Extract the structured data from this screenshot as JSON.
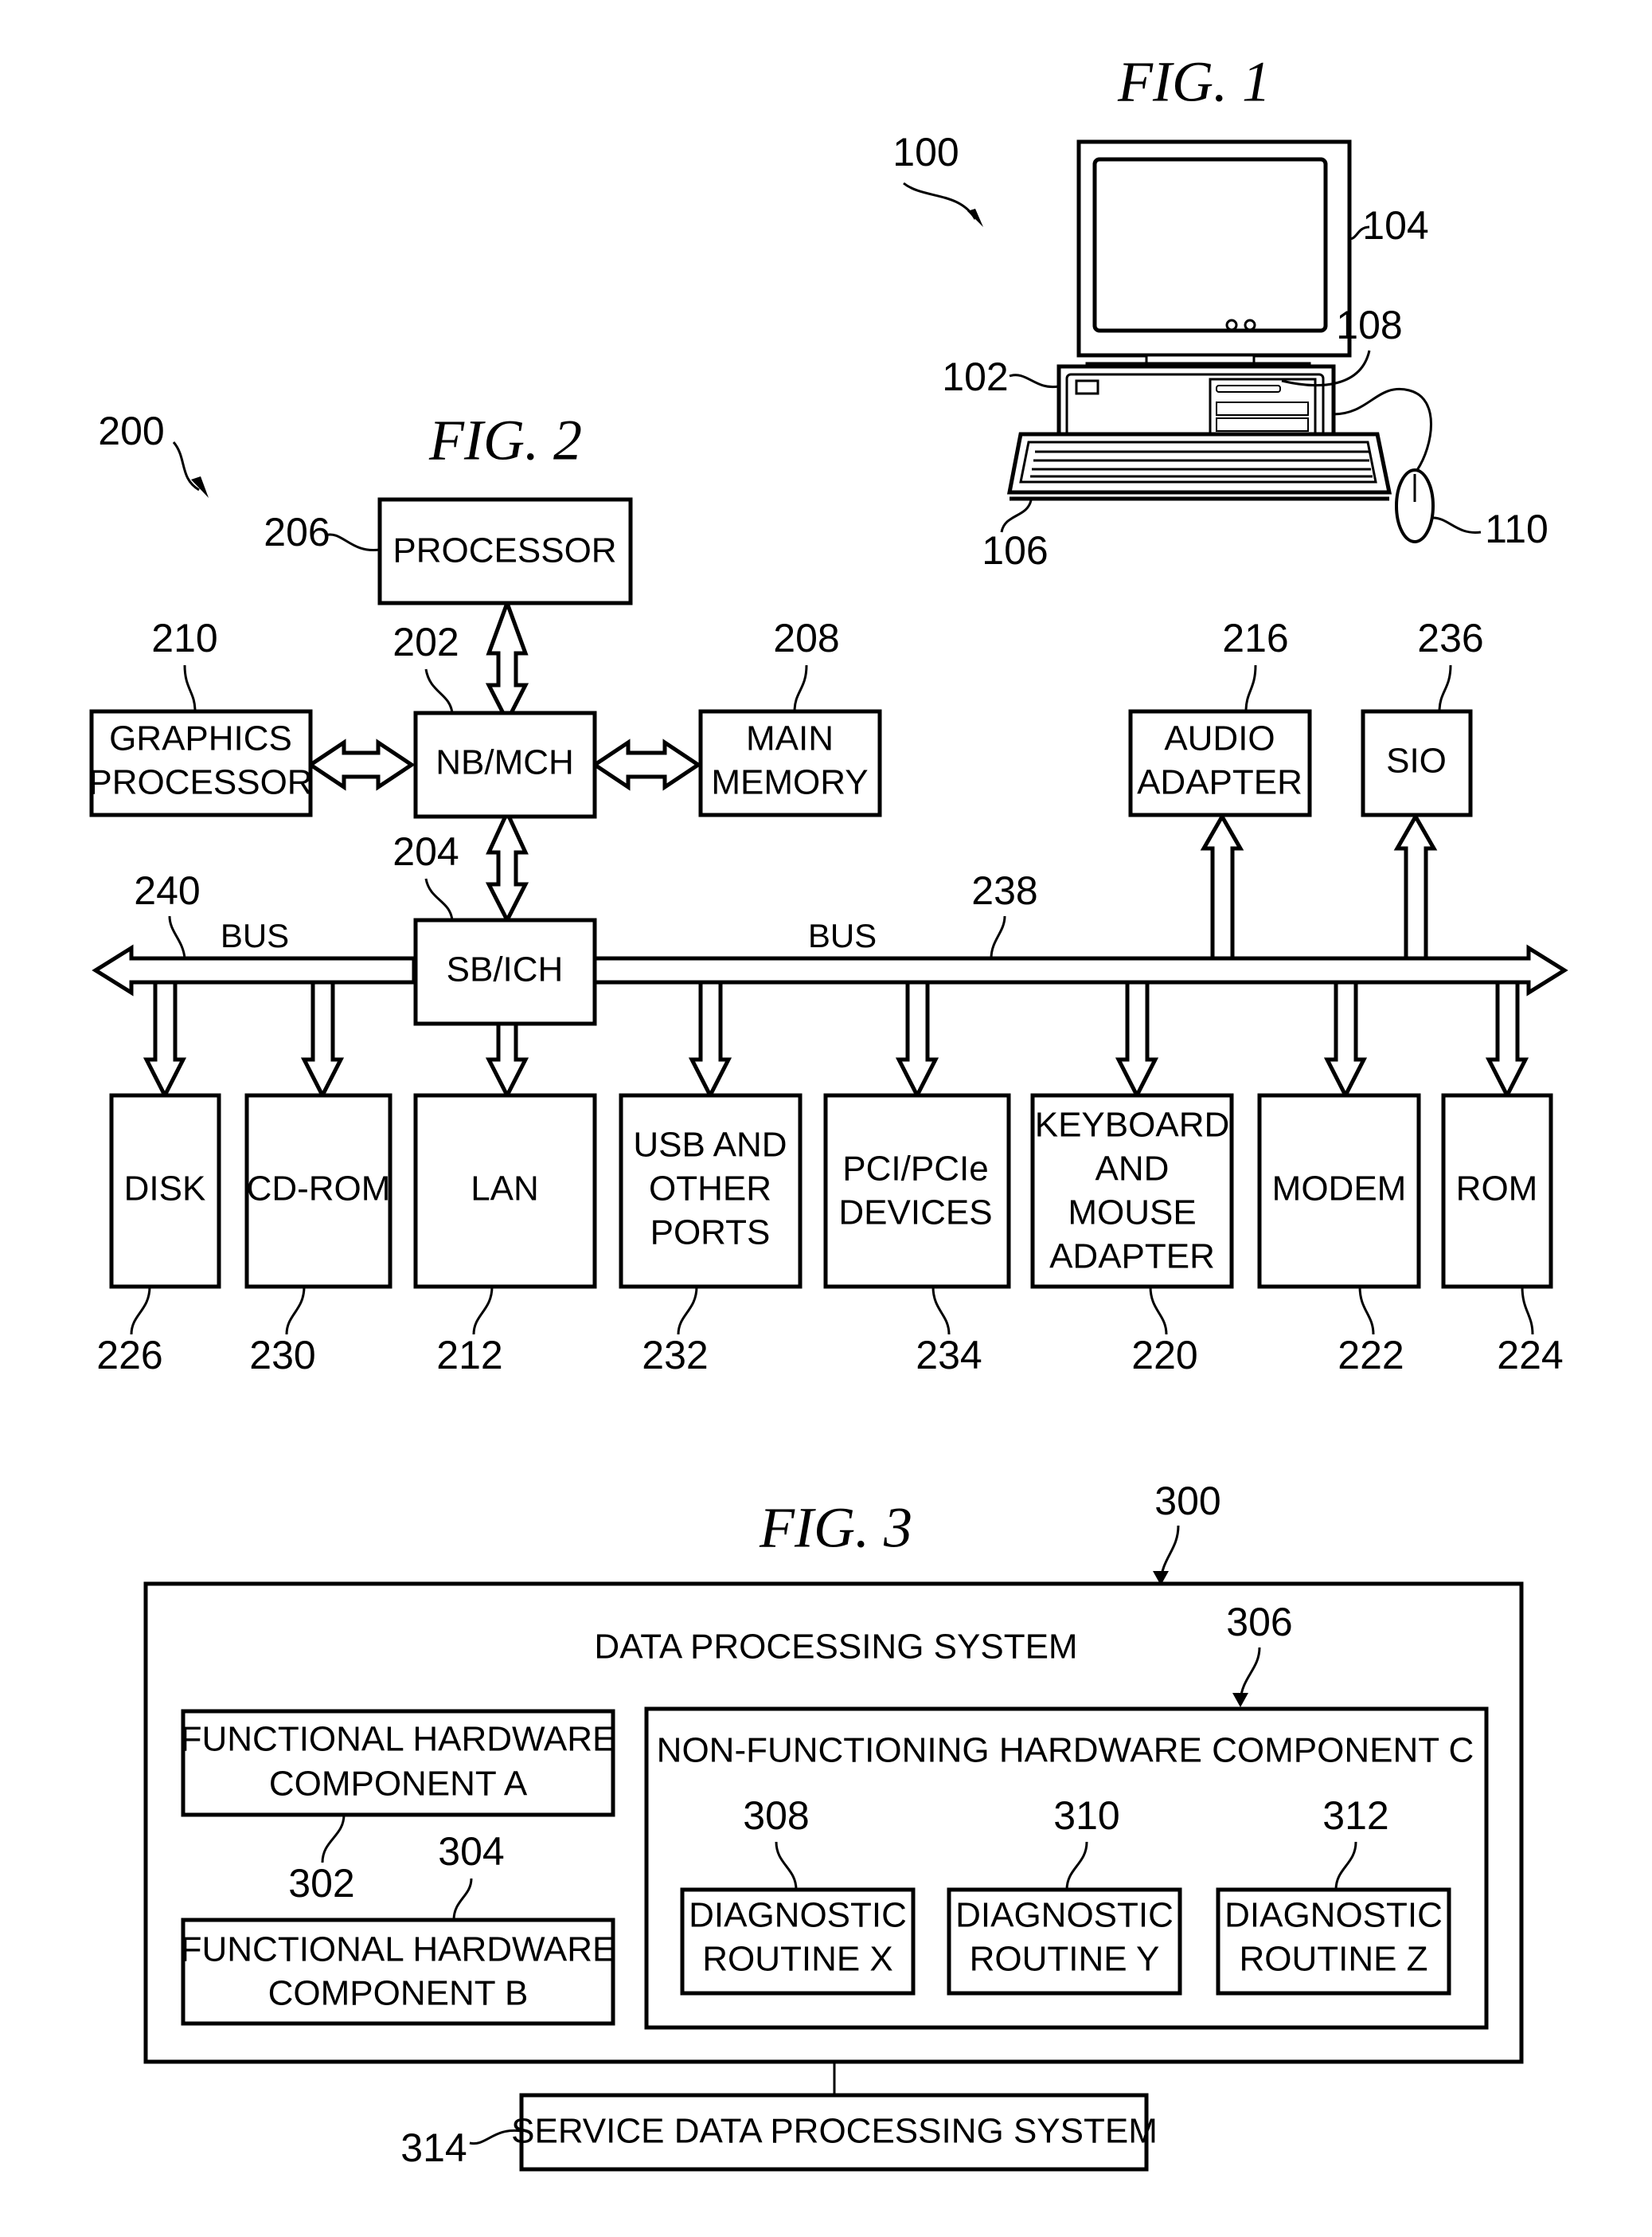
{
  "fig1": {
    "title": "FIG. 1",
    "refs": {
      "system": "100",
      "computer": "102",
      "monitor": "104",
      "keyboard": "106",
      "storage": "108",
      "mouse": "110"
    }
  },
  "fig2": {
    "title": "FIG. 2",
    "system_ref": "200",
    "bus_label": "BUS",
    "bus_left_ref": "240",
    "bus_right_ref": "238",
    "blocks": {
      "processor": {
        "lines": [
          "PROCESSOR"
        ],
        "ref": "206"
      },
      "nb_mch": {
        "lines": [
          "NB/MCH"
        ],
        "ref": "202"
      },
      "sb_ich": {
        "lines": [
          "SB/ICH"
        ],
        "ref": "204"
      },
      "graphics": {
        "lines": [
          "GRAPHICS",
          "PROCESSOR"
        ],
        "ref": "210"
      },
      "main_memory": {
        "lines": [
          "MAIN",
          "MEMORY"
        ],
        "ref": "208"
      },
      "audio": {
        "lines": [
          "AUDIO",
          "ADAPTER"
        ],
        "ref": "216"
      },
      "sio": {
        "lines": [
          "SIO"
        ],
        "ref": "236"
      },
      "disk": {
        "lines": [
          "DISK"
        ],
        "ref": "226"
      },
      "cdrom": {
        "lines": [
          "CD-ROM"
        ],
        "ref": "230"
      },
      "lan": {
        "lines": [
          "LAN"
        ],
        "ref": "212"
      },
      "usb": {
        "lines": [
          "USB AND",
          "OTHER",
          "PORTS"
        ],
        "ref": "232"
      },
      "pci": {
        "lines": [
          "PCI/PCIe",
          "DEVICES"
        ],
        "ref": "234"
      },
      "kbd_mouse": {
        "lines": [
          "KEYBOARD",
          "AND",
          "MOUSE",
          "ADAPTER"
        ],
        "ref": "220"
      },
      "modem": {
        "lines": [
          "MODEM"
        ],
        "ref": "222"
      },
      "rom": {
        "lines": [
          "ROM"
        ],
        "ref": "224"
      }
    }
  },
  "fig3": {
    "title": "FIG. 3",
    "system_ref": "300",
    "system_label": "DATA PROCESSING SYSTEM",
    "component_a": {
      "lines": [
        "FUNCTIONAL HARDWARE",
        "COMPONENT A"
      ],
      "ref": "302"
    },
    "component_b": {
      "lines": [
        "FUNCTIONAL HARDWARE",
        "COMPONENT B"
      ],
      "ref": "304"
    },
    "component_c": {
      "label": "NON-FUNCTIONING HARDWARE COMPONENT C",
      "ref": "306"
    },
    "routines": [
      {
        "lines": [
          "DIAGNOSTIC",
          "ROUTINE X"
        ],
        "ref": "308"
      },
      {
        "lines": [
          "DIAGNOSTIC",
          "ROUTINE Y"
        ],
        "ref": "310"
      },
      {
        "lines": [
          "DIAGNOSTIC",
          "ROUTINE Z"
        ],
        "ref": "312"
      }
    ],
    "service": {
      "label": "SERVICE DATA PROCESSING SYSTEM",
      "ref": "314"
    }
  }
}
